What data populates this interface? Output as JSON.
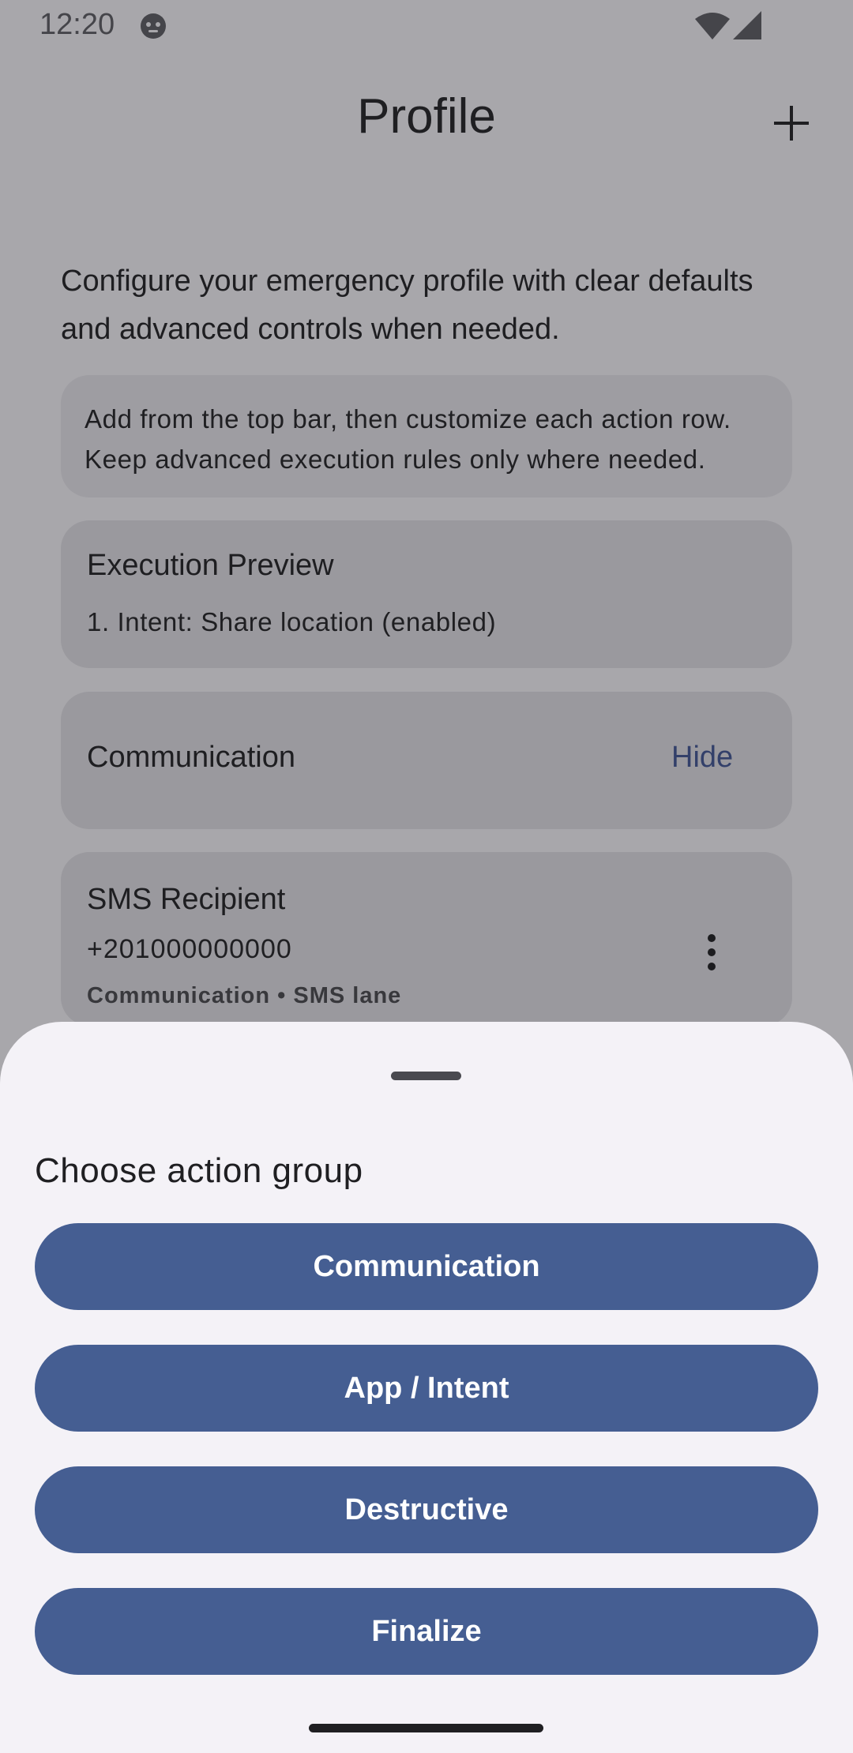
{
  "status_bar": {
    "time": "12:20",
    "icons": [
      "app-notification-icon",
      "wifi-icon",
      "cell-signal-icon"
    ]
  },
  "top_bar": {
    "title": "Profile",
    "add_icon": "plus-icon"
  },
  "content": {
    "intro": "Configure your emergency profile with clear defaults and advanced controls when needed.",
    "hint": "Add from the top bar, then customize each action row. Keep advanced execution rules only where needed.",
    "preview": {
      "title": "Execution Preview",
      "items": [
        "1. Intent: Share location (enabled)"
      ]
    },
    "communication": {
      "title": "Communication",
      "toggle_label": "Hide"
    },
    "sms": {
      "title": "SMS Recipient",
      "number": "+201000000000",
      "meta": "Communication • SMS lane",
      "menu_icon": "more-vert-icon"
    }
  },
  "sheet": {
    "title": "Choose action group",
    "buttons": [
      {
        "label": "Communication"
      },
      {
        "label": "App / Intent"
      },
      {
        "label": "Destructive"
      },
      {
        "label": "Finalize"
      }
    ]
  },
  "colors": {
    "scrim_background": "#a8a7ab",
    "card_background": "#9a999e",
    "sheet_background": "#f4f2f7",
    "primary_button": "#455e92",
    "link": "#33406a"
  }
}
